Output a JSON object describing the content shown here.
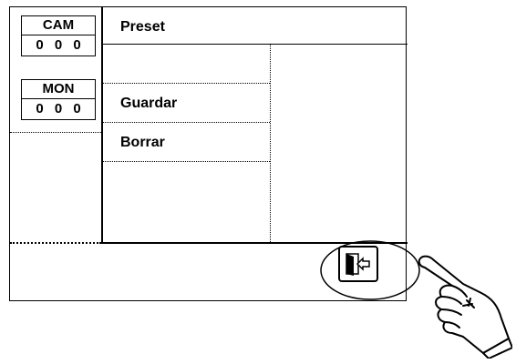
{
  "sidebar": {
    "cam": {
      "label": "CAM",
      "value": "0 0 0"
    },
    "mon": {
      "label": "MON",
      "value": "0 0 0"
    }
  },
  "main": {
    "title": "Preset",
    "menu": [
      {
        "label": ""
      },
      {
        "label": "Guardar"
      },
      {
        "label": "Borrar"
      }
    ]
  },
  "exit": {
    "icon": "exit-door-icon"
  },
  "pointer": {
    "icon": "pointing-hand-icon"
  }
}
